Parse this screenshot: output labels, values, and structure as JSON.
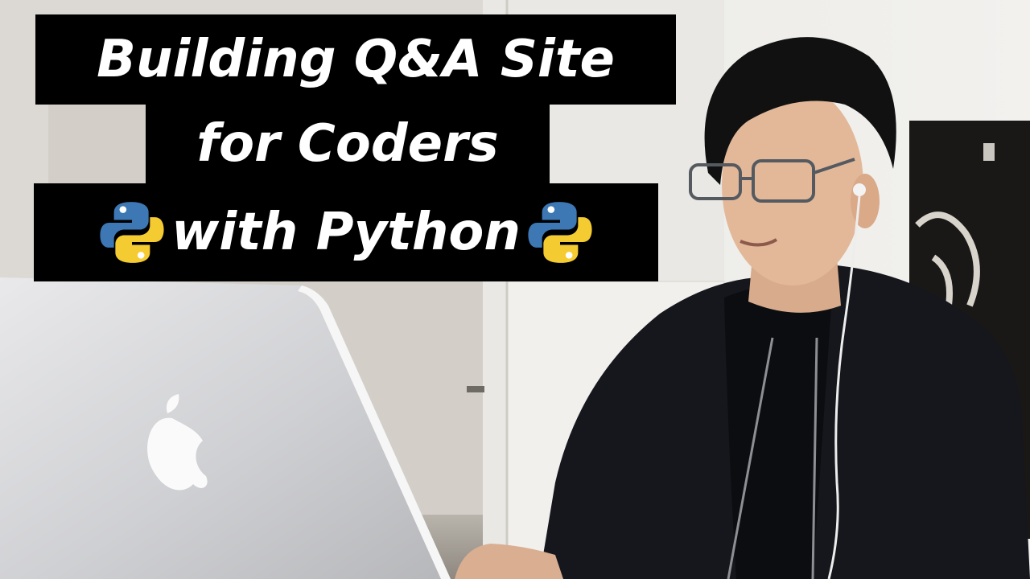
{
  "thumbnail": {
    "title_lines": [
      "Building Q&A Site",
      "for Coders",
      "with Python"
    ],
    "icons": [
      "python-logo-icon",
      "python-logo-icon"
    ],
    "colors": {
      "title_background": "#000000",
      "title_text": "#ffffff",
      "python_blue": "#3d78b4",
      "python_yellow": "#f5cb32"
    }
  }
}
